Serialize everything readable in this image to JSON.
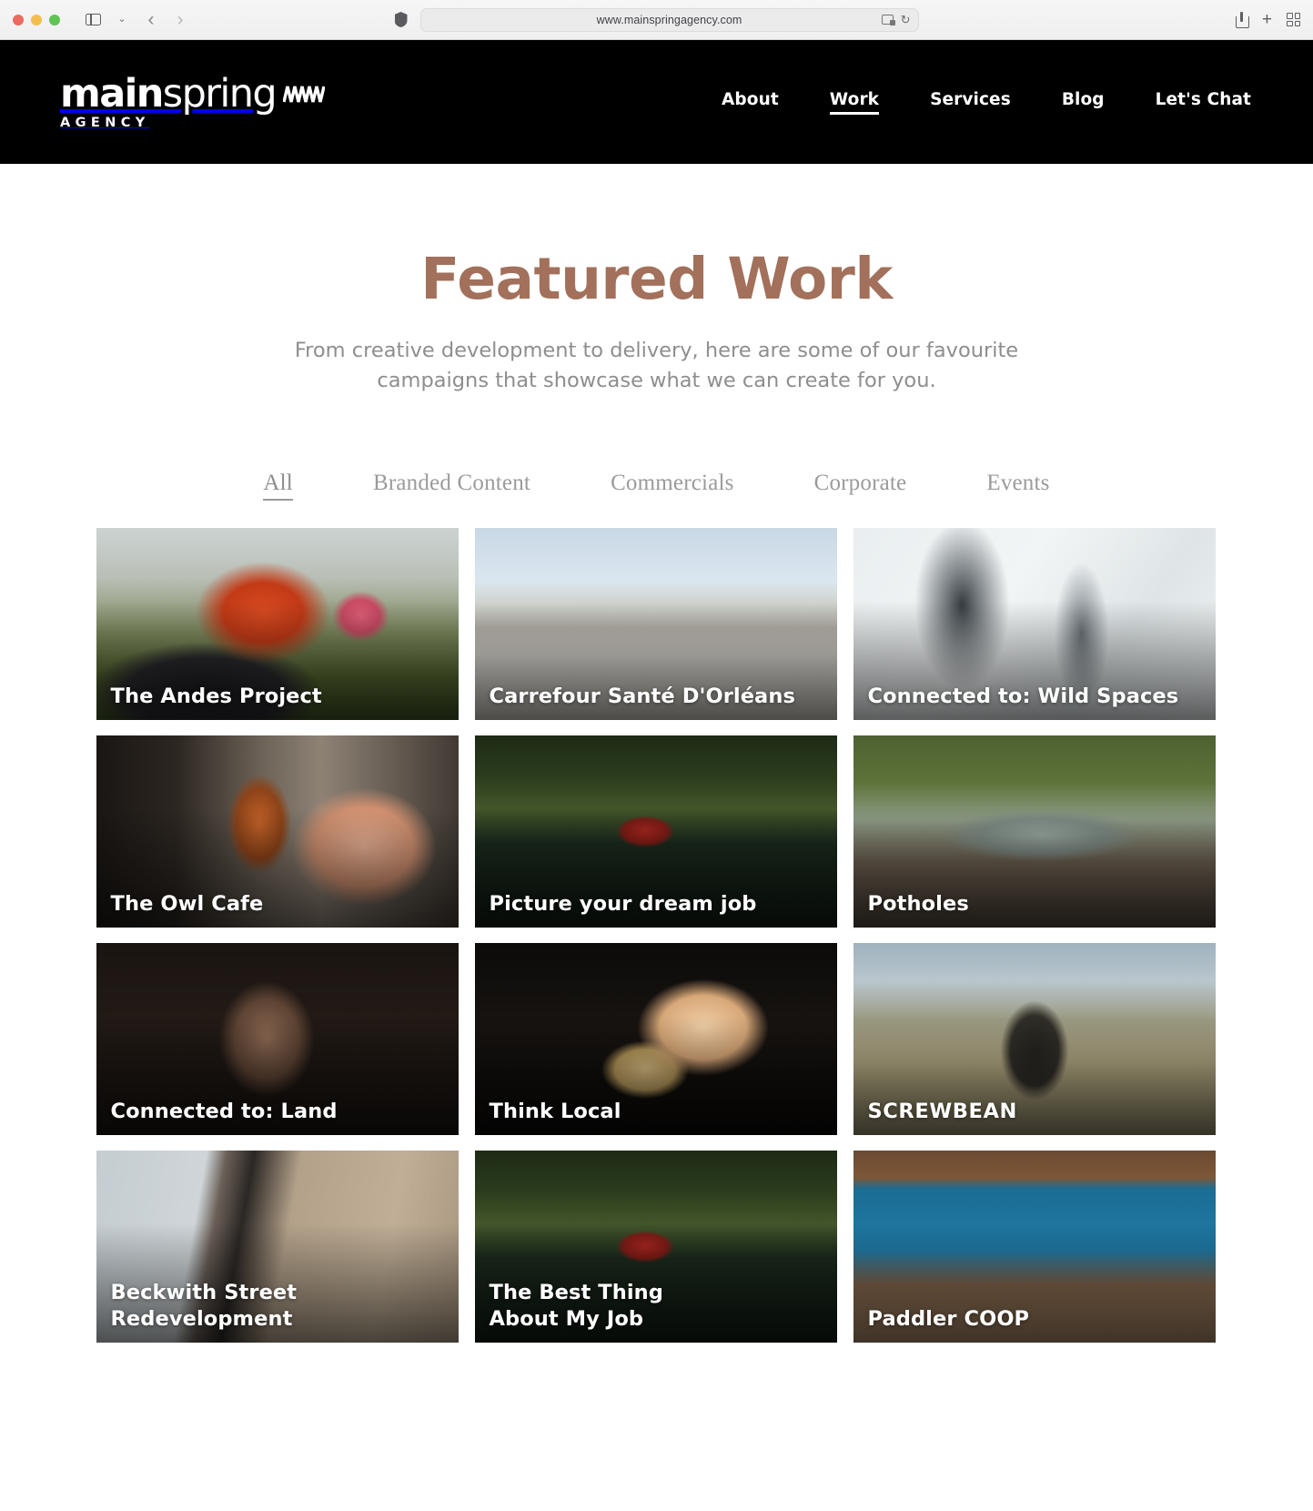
{
  "browser": {
    "url": "www.mainspringagency.com",
    "traffic_lights": [
      "close",
      "minimize",
      "zoom"
    ],
    "icons": {
      "sidebar": "sidebar-icon",
      "sidebar_chevron": "⌄",
      "back": "‹",
      "forward": "›",
      "shield": "shield-icon",
      "extension": "extension-icon",
      "reload": "↻",
      "share": "share-icon",
      "new_tab": "+",
      "tab_overview": "tab-overview-icon"
    }
  },
  "site_header": {
    "logo": {
      "main_bold": "main",
      "main_light": "spring",
      "mark": "spring-zigzag-mark",
      "sub": "AGENCY"
    },
    "nav": [
      {
        "label": "About",
        "active": false
      },
      {
        "label": "Work",
        "active": true
      },
      {
        "label": "Services",
        "active": false
      },
      {
        "label": "Blog",
        "active": false
      },
      {
        "label": "Let's Chat",
        "active": false
      }
    ]
  },
  "page": {
    "title": "Featured Work",
    "title_color": "#a2705b",
    "subtitle": "From creative development to delivery, here are some of our favourite campaigns that showcase what we can create for you."
  },
  "filters": [
    {
      "label": "All",
      "active": true
    },
    {
      "label": "Branded Content",
      "active": false
    },
    {
      "label": "Commercials",
      "active": false
    },
    {
      "label": "Corporate",
      "active": false
    },
    {
      "label": "Events",
      "active": false
    }
  ],
  "work_items": [
    {
      "title": "The Andes Project",
      "photo": "ph-andes",
      "caps": false
    },
    {
      "title": "Carrefour Santé D'Orléans",
      "photo": "ph-carrefour",
      "caps": false
    },
    {
      "title": "Connected to: Wild Spaces",
      "photo": "ph-wild",
      "caps": false
    },
    {
      "title": "The Owl Cafe",
      "photo": "ph-owl",
      "caps": false
    },
    {
      "title": "Picture your dream job",
      "photo": "ph-canoe",
      "caps": false
    },
    {
      "title": "Potholes",
      "photo": "ph-potholes",
      "caps": false
    },
    {
      "title": "Connected to: Land",
      "photo": "ph-land",
      "caps": false
    },
    {
      "title": "Think Local",
      "photo": "ph-thinklocal",
      "caps": false
    },
    {
      "title": "SCREWBEAN",
      "photo": "ph-screwbean",
      "caps": true
    },
    {
      "title": "Beckwith Street\nRedevelopment",
      "photo": "ph-beckwith",
      "caps": false
    },
    {
      "title": "The Best Thing\nAbout My Job",
      "photo": "ph-canoe",
      "caps": false
    },
    {
      "title": "Paddler COOP",
      "photo": "ph-paddler",
      "caps": false
    }
  ]
}
